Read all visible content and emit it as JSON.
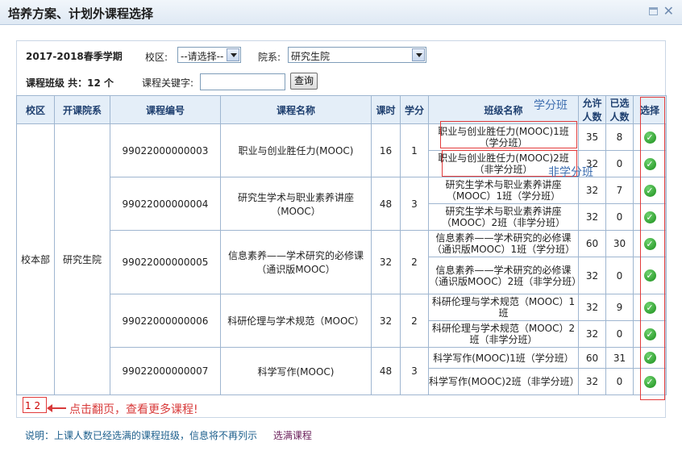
{
  "window": {
    "title": "培养方案、计划外课程选择"
  },
  "filters": {
    "term": "2017-2018春季学期",
    "campus_label": "校区:",
    "campus_value": "--请选择--",
    "dept_label": "院系:",
    "dept_value": "研究生院",
    "count_text": "课程班级 共：12 个",
    "keyword_label": "课程关键字:",
    "keyword_value": "",
    "query_button": "查询"
  },
  "table": {
    "headers": [
      "校区",
      "开课院系",
      "课程编号",
      "课程名称",
      "课时",
      "学分",
      "班级名称",
      "允许人数",
      "已选人数",
      "选择"
    ],
    "campus": "校本部",
    "dept": "研究生院",
    "courses": [
      {
        "code": "99022000000003",
        "name": "职业与创业胜任力(MOOC)",
        "hours": "16",
        "credit": "1",
        "classes": [
          {
            "name": "职业与创业胜任力(MOOC)1班（学分班）",
            "allow": "35",
            "chosen": "8"
          },
          {
            "name": "职业与创业胜任力(MOOC)2班（非学分班）",
            "allow": "32",
            "chosen": "0"
          }
        ]
      },
      {
        "code": "99022000000004",
        "name": "研究生学术与职业素养讲座（MOOC）",
        "hours": "48",
        "credit": "3",
        "classes": [
          {
            "name": "研究生学术与职业素养讲座（MOOC）1班（学分班）",
            "allow": "32",
            "chosen": "7"
          },
          {
            "name": "研究生学术与职业素养讲座（MOOC）2班（非学分班）",
            "allow": "32",
            "chosen": "0"
          }
        ]
      },
      {
        "code": "99022000000005",
        "name": "信息素养——学术研究的必修课（通识版MOOC）",
        "hours": "32",
        "credit": "2",
        "classes": [
          {
            "name": "信息素养——学术研究的必修课（通识版MOOC）1班（学分班）",
            "allow": "60",
            "chosen": "30"
          },
          {
            "name": "信息素养——学术研究的必修课（通识版MOOC）2班（非学分班）",
            "allow": "32",
            "chosen": "0"
          }
        ]
      },
      {
        "code": "99022000000006",
        "name": "科研伦理与学术规范（MOOC）",
        "hours": "32",
        "credit": "2",
        "classes": [
          {
            "name": "科研伦理与学术规范（MOOC）1班",
            "allow": "32",
            "chosen": "9"
          },
          {
            "name": "科研伦理与学术规范（MOOC）2班（非学分班）",
            "allow": "32",
            "chosen": "0"
          }
        ]
      },
      {
        "code": "99022000000007",
        "name": "科学写作(MOOC)",
        "hours": "48",
        "credit": "3",
        "classes": [
          {
            "name": "科学写作(MOOC)1班（学分班）",
            "allow": "60",
            "chosen": "31"
          },
          {
            "name": "科学写作(MOOC)2班（非学分班）",
            "allow": "32",
            "chosen": "0"
          }
        ]
      }
    ]
  },
  "pager": {
    "page1": "1",
    "page2": "2"
  },
  "footer": {
    "note": "说明：上课人数已经选满的课程班级，信息将不再列示",
    "full_link": "选满课程"
  },
  "annotations": {
    "credit_class": "学分班",
    "noncredit_class": "非学分班",
    "pager_hint": "点击翻页，查看更多课程!"
  }
}
